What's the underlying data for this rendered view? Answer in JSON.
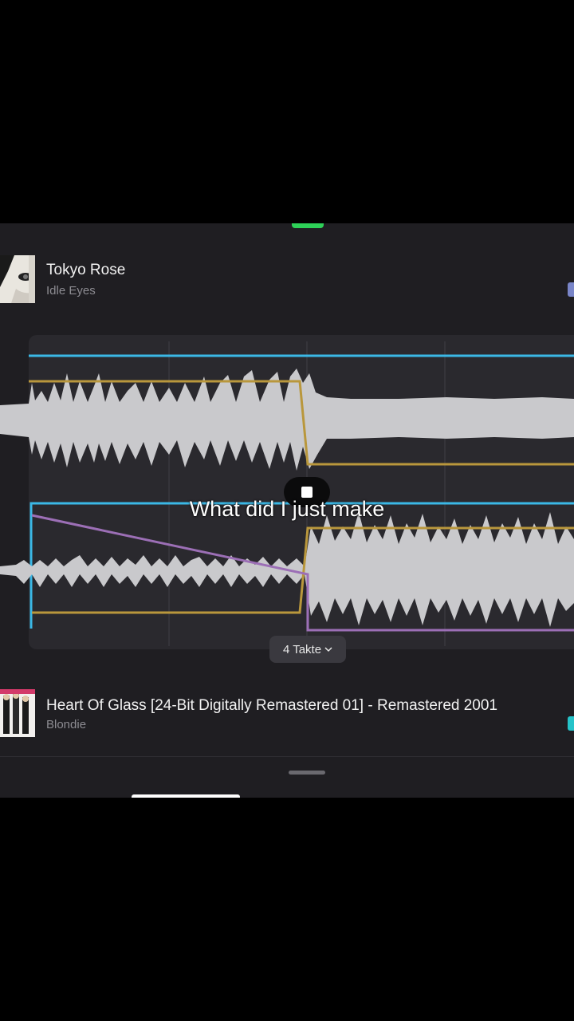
{
  "tracks": {
    "top": {
      "title": "Tokyo Rose",
      "artist": "Idle Eyes"
    },
    "bottom": {
      "title": "Heart Of Glass [24-Bit Digitally Remastered 01] - Remastered 2001",
      "artist": "Blondie"
    }
  },
  "editor": {
    "bars_label": "4 Takte",
    "colors": {
      "top_track": "#3bb8e6",
      "bottom_track": "#3bb8e6",
      "volume": "#b9973c",
      "filter": "#9c6fb6",
      "waveform": "#c9c9cc"
    }
  },
  "overlay": {
    "caption": "What did I just make"
  },
  "icons": {
    "stop": "stop-icon",
    "chevron": "chevron-down-icon"
  }
}
